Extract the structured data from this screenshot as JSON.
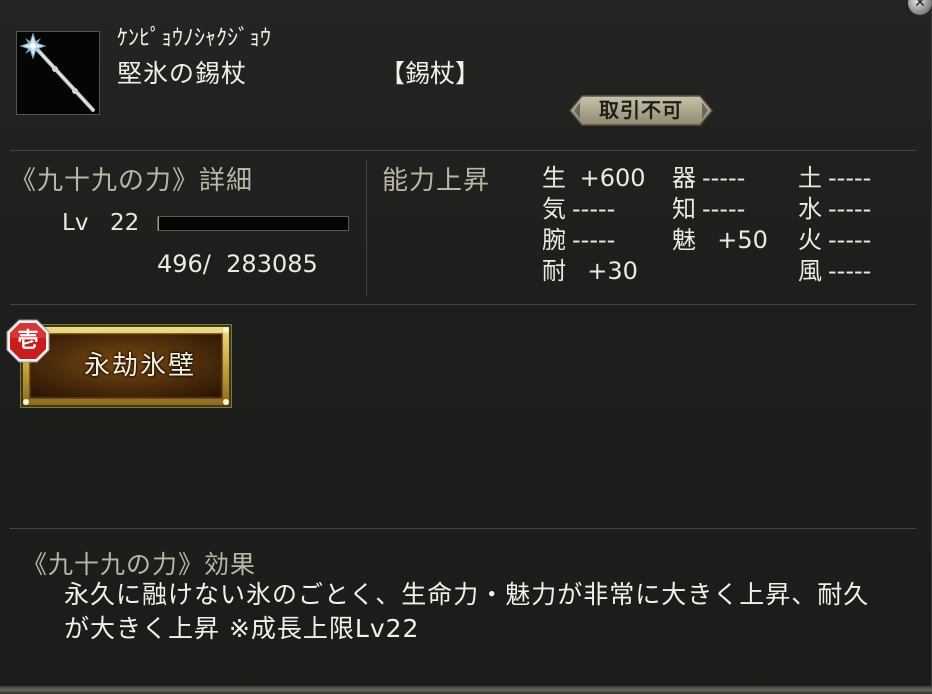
{
  "item": {
    "reading": "ｹﾝﾋﾟｮｳﾉｼｬｸｼﾞｮｳ",
    "name": "堅氷の錫杖",
    "type": "【錫杖】",
    "trade_status": "取引不可",
    "icon": "ice-staff-icon"
  },
  "detail": {
    "title": "《九十九の力》詳細",
    "lv_label": "Lv",
    "lv_value": "22",
    "exp_text": "496/  283085",
    "exp_fraction": 0.0017
  },
  "ability": {
    "title": "能力上昇",
    "stats": [
      {
        "label": "生",
        "value": " +600"
      },
      {
        "label": "器",
        "value": "-----"
      },
      {
        "label": "土",
        "value": "-----"
      },
      {
        "label": "気",
        "value": "-----"
      },
      {
        "label": "知",
        "value": "-----"
      },
      {
        "label": "水",
        "value": "-----"
      },
      {
        "label": "腕",
        "value": "-----"
      },
      {
        "label": "魅",
        "value": "  +50"
      },
      {
        "label": "火",
        "value": "-----"
      },
      {
        "label": "耐",
        "value": "  +30"
      },
      {
        "label": "風",
        "value": "-----"
      }
    ]
  },
  "skill": {
    "rank": "壱",
    "name": "永劫氷壁"
  },
  "effect": {
    "title": "《九十九の力》効果",
    "text": "永久に融けない氷のごとく、生命力・魅力が非常に大きく上昇、耐久が大きく上昇 ※成長上限Lv22"
  },
  "colors": {
    "background": "#1d1d1b",
    "section_title": "#bab6a6",
    "text": "#ece9dd",
    "skill_gold": "#c9a440",
    "rank_red": "#c81d1d"
  }
}
